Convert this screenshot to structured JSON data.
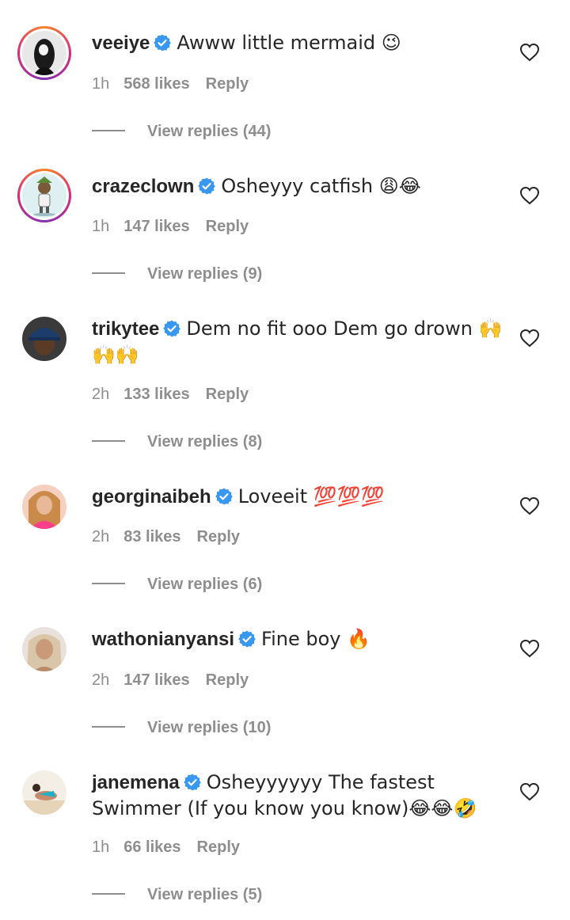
{
  "comments": [
    {
      "username": "veeiye",
      "text": "Awww little mermaid 😉",
      "time": "1h",
      "likes": "568 likes",
      "reply": "Reply",
      "view_replies": "View replies (44)"
    },
    {
      "username": "crazeclown",
      "text": "Osheyyy catfish 😩😂",
      "time": "1h",
      "likes": "147 likes",
      "reply": "Reply",
      "view_replies": "View replies (9)"
    },
    {
      "username": "trikytee",
      "text": "Dem no fit ooo Dem go drown 🙌🙌🙌",
      "time": "2h",
      "likes": "133 likes",
      "reply": "Reply",
      "view_replies": "View replies (8)"
    },
    {
      "username": "georginaibeh",
      "text": "Loveeit 💯💯💯",
      "time": "2h",
      "likes": "83 likes",
      "reply": "Reply",
      "view_replies": "View replies (6)"
    },
    {
      "username": "wathonianyansi",
      "text": "Fine boy 🔥",
      "time": "2h",
      "likes": "147 likes",
      "reply": "Reply",
      "view_replies": "View replies (10)"
    },
    {
      "username": "janemena",
      "text": "Osheyyyyyy The fastest Swimmer (If you know you know)😂😂🤣",
      "time": "1h",
      "likes": "66 likes",
      "reply": "Reply",
      "view_replies": "View replies (5)"
    }
  ],
  "colors": {
    "verified": "#3897f0",
    "muted": "#8e8e8e",
    "text": "#262626"
  },
  "icons": {
    "verified": "verified-badge-icon",
    "like": "heart-outline-icon"
  }
}
